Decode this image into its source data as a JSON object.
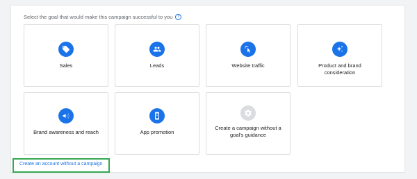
{
  "goal_prompt": "Select the goal that would make this campaign successful to you",
  "help_icon_glyph": "?",
  "goals": [
    {
      "label": "Sales",
      "icon": "tag-icon"
    },
    {
      "label": "Leads",
      "icon": "people-icon"
    },
    {
      "label": "Website traffic",
      "icon": "cursor-click-icon"
    },
    {
      "label": "Product and brand consideration",
      "icon": "sparkle-icon"
    },
    {
      "label": "Brand awareness and reach",
      "icon": "megaphone-icon"
    },
    {
      "label": "App promotion",
      "icon": "phone-icon"
    },
    {
      "label": "Create a campaign without a goal's guidance",
      "icon": "gear-icon"
    }
  ],
  "create_account_link": "Create an account without a campaign",
  "colors": {
    "accent": "#1a73e8",
    "highlight": "#34a853",
    "neutral_icon": "#dadce0"
  }
}
